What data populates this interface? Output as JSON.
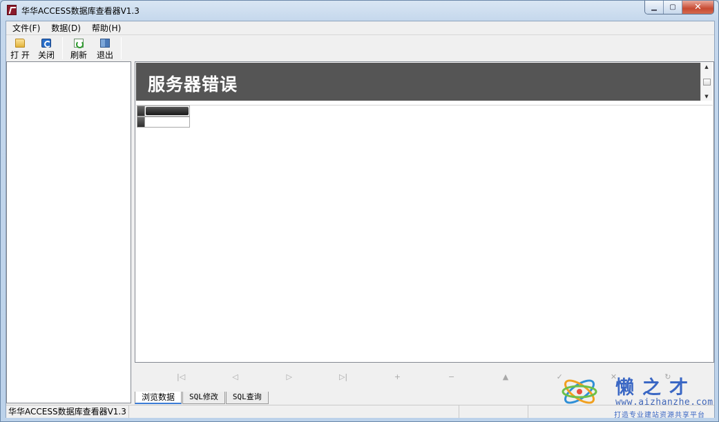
{
  "window": {
    "title": "华华ACCESS数据库查看器V1.3"
  },
  "window_controls": {
    "minimize": "▁",
    "maximize": "▢",
    "close": "✕"
  },
  "menu": [
    {
      "label": "文件(F)"
    },
    {
      "label": "数据(D)"
    },
    {
      "label": "帮助(H)"
    }
  ],
  "toolbar": {
    "open": "打 开",
    "close": "关闭",
    "refresh": "刷新",
    "exit": "退出"
  },
  "error": {
    "title": "服务器错误"
  },
  "navigator": {
    "first": "|◁",
    "prior": "◁",
    "next": "▷",
    "last": "▷|",
    "insert": "+",
    "delete": "−",
    "edit": "▲",
    "post": "✓",
    "cancel": "✕",
    "refresh": "↻"
  },
  "tabs": [
    {
      "label": "浏览数据"
    },
    {
      "label": "SQL修改"
    },
    {
      "label": "SQL查询"
    }
  ],
  "status": {
    "text": "华华ACCESS数据库查看器V1.3"
  },
  "watermark": {
    "brand": "懒之才",
    "url": "www.aizhanzhe.com",
    "slogan": "打造专业建站资源共享平台"
  },
  "colors": {
    "error_banner": "#555555",
    "watermark_blue": "#3a67c4"
  }
}
